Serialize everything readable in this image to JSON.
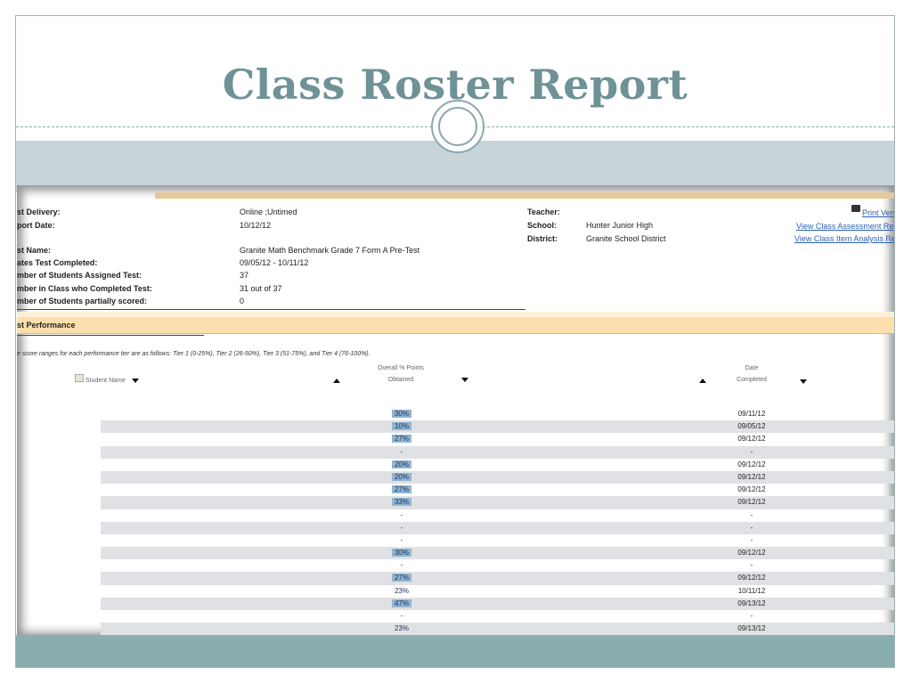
{
  "slide": {
    "title": "Class Roster Report"
  },
  "report": {
    "fields_left": [
      {
        "label": "st Delivery:",
        "value": "Online ;Untimed"
      },
      {
        "label": "port Date:",
        "value": "10/12/12"
      },
      {
        "label": "st Name:",
        "value": "Granite Math Benchmark Grade 7 Form A Pre-Test"
      },
      {
        "label": "ates Test Completed:",
        "value": "09/05/12 - 10/11/12"
      },
      {
        "label": "mber of Students Assigned Test:",
        "value": "37"
      },
      {
        "label": "mber in Class who Completed Test:",
        "value": "31 out of 37"
      },
      {
        "label": "mber of Students partially scored:",
        "value": "0"
      }
    ],
    "teacher_label": "Teacher:",
    "teacher_value": "",
    "school_label": "School:",
    "school_value": "Hunter Junior High",
    "district_label": "District:",
    "district_value": "Granite School District",
    "links": {
      "print": "Print Vers",
      "assessment": "View Class Assessment Rep",
      "item_analysis": "View Class Item Analysis Rep"
    },
    "section_title": "st Performance",
    "tier_note": "e score ranges for each performance tier are as follows: Tier 1 (0-25%), Tier 2 (26-50%), Tier 3 (51-75%), and Tier 4 (76-100%).",
    "columns": {
      "student_name": "Student Name",
      "overall_line1": "Overall % Points",
      "overall_line2": "Obtained",
      "date_line1": "Date",
      "date_line2": "Completed"
    },
    "rows": [
      {
        "pct": "30%",
        "date": "09/11/12"
      },
      {
        "pct": "10%",
        "date": "09/05/12"
      },
      {
        "pct": "27%",
        "date": "09/12/12"
      },
      {
        "pct": "-",
        "date": "-"
      },
      {
        "pct": "20%",
        "date": "09/12/12"
      },
      {
        "pct": "20%",
        "date": "09/12/12"
      },
      {
        "pct": "27%",
        "date": "09/12/12"
      },
      {
        "pct": "33%",
        "date": "09/12/12"
      },
      {
        "pct": "-",
        "date": "-"
      },
      {
        "pct": "-",
        "date": "-"
      },
      {
        "pct": "-",
        "date": "-"
      },
      {
        "pct": "30%",
        "date": "09/12/12"
      },
      {
        "pct": "-",
        "date": "-"
      },
      {
        "pct": "27%",
        "date": "09/12/12"
      },
      {
        "pct": "23%",
        "date": "10/11/12"
      },
      {
        "pct": "47%",
        "date": "09/13/12"
      },
      {
        "pct": "-",
        "date": "-"
      },
      {
        "pct": "23%",
        "date": "09/13/12"
      }
    ]
  }
}
